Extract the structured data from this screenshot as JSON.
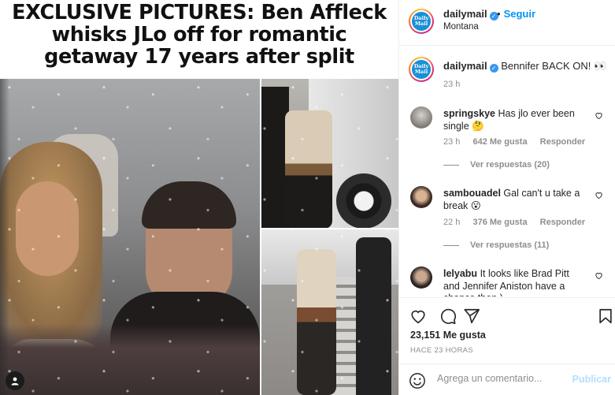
{
  "media": {
    "headline_line1": "EXCLUSIVE PICTURES: Ben Affleck",
    "headline_line2": "whisks JLo off for romantic",
    "headline_line3": "getaway 17 years after split"
  },
  "header": {
    "username": "dailymail",
    "follow_label": "Seguir",
    "separator": "•",
    "location": "Montana",
    "avatar_text_1": "Daily",
    "avatar_text_2": "Mail"
  },
  "caption": {
    "username": "dailymail",
    "text": "Bennifer BACK ON! 👀",
    "time": "23 h"
  },
  "comments": [
    {
      "username": "springskye",
      "text": "Has jlo ever been single 🤔",
      "time": "23 h",
      "likes": "642 Me gusta",
      "reply": "Responder",
      "view_replies": "Ver respuestas (20)"
    },
    {
      "username": "sambouadel",
      "text": "Gal can't u take a break 😮",
      "time": "22 h",
      "likes": "376 Me gusta",
      "reply": "Responder",
      "view_replies": "Ver respuestas (11)"
    },
    {
      "username": "lelyabu",
      "text": "It looks like Brad Pitt and Jennifer Aniston have a chance then )"
    }
  ],
  "actions": {
    "likes": "23,151 Me gusta",
    "time_ago": "HACE 23 HORAS",
    "comment_placeholder": "Agrega un comentario...",
    "publish_label": "Publicar"
  },
  "icons": {
    "heart": "heart-icon",
    "comment": "comment-icon",
    "share": "paper-plane-icon",
    "save": "bookmark-icon",
    "emoji": "smiley-icon",
    "user_tag": "user-icon"
  },
  "colors": {
    "accent_blue": "#0095f6",
    "verified_blue": "#3897f0",
    "muted_text": "#8e8e8e",
    "publish_disabled": "#b2dffc"
  }
}
